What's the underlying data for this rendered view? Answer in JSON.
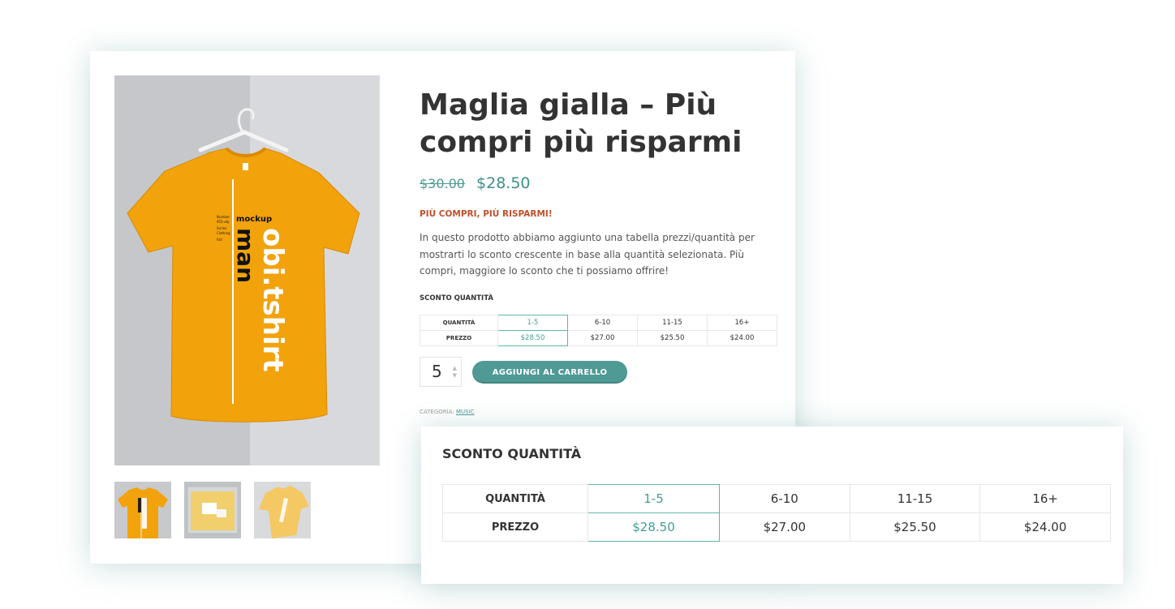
{
  "product": {
    "title": "Maglia gialla – Più compri più risparmi",
    "old_price": "$30.00",
    "new_price": "$28.50",
    "promo": "PIÙ COMPRI, PIÙ RISPARMI!",
    "description": "In questo prodotto abbiamo aggiunto una tabella prezzi/quantità per mostrarti lo sconto crescente in base alla quantità selezionata. Più compri, maggiore lo sconto che ti possiamo offrire!",
    "category_label": "CATEGORIA:",
    "category_link": "MUSIC"
  },
  "shirt": {
    "brand_line1": "obi.tshirt",
    "brand_line2": "man",
    "mockup": "mockup",
    "tag_text": "Number 955-obj. Series Clothing Fall Fall"
  },
  "discount": {
    "label": "SCONTO QUANTITÀ",
    "quantity_header": "QUANTITÀ",
    "price_header": "PREZZO",
    "tiers": [
      {
        "range": "1-5",
        "price": "$28.50",
        "selected": true
      },
      {
        "range": "6-10",
        "price": "$27.00",
        "selected": false
      },
      {
        "range": "11-15",
        "price": "$25.50",
        "selected": false
      },
      {
        "range": "16+",
        "price": "$24.00",
        "selected": false
      }
    ]
  },
  "cart": {
    "quantity": "5",
    "add_button": "AGGIUNGI AL CARRELLO"
  },
  "zoom": {
    "title": "SCONTO QUANTITÀ"
  },
  "colors": {
    "accent": "#4f9a95",
    "promo": "#c0502a",
    "shirt": "#f2a20a"
  }
}
